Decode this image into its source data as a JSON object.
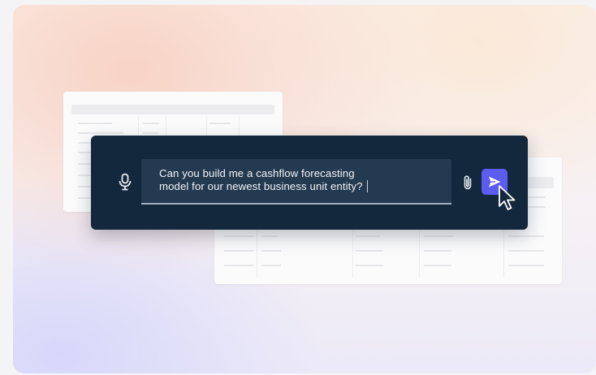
{
  "prompt": {
    "text_line1": "Can you build me a cashflow forecasting",
    "text_line2": "model for our newest business unit entity?"
  },
  "icons": {
    "mic": "microphone-icon",
    "attach": "paperclip-icon",
    "send": "paper-plane-icon",
    "cursor": "mouse-pointer-icon"
  },
  "colors": {
    "panel": "#13283d",
    "input": "#243a51",
    "accent": "#5b5cf0"
  }
}
